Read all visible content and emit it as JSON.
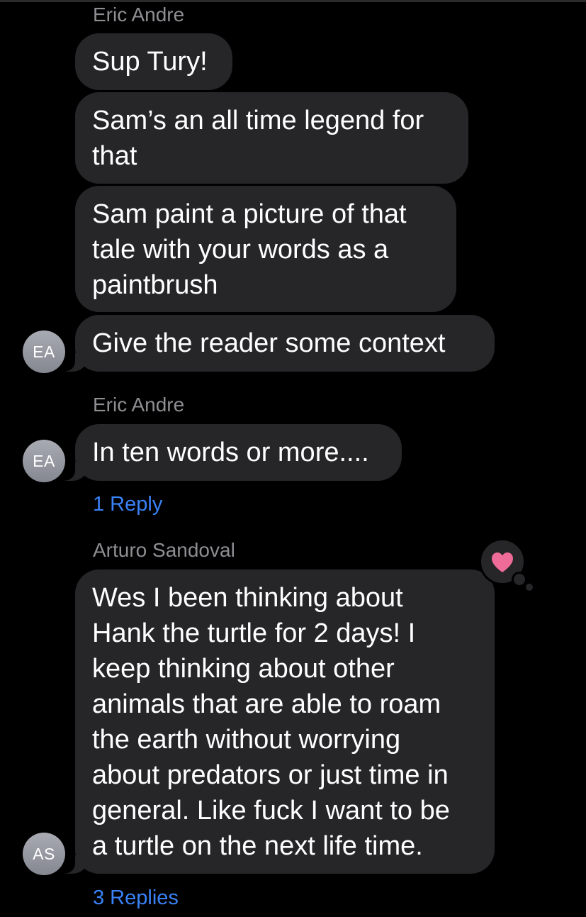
{
  "colors": {
    "background": "#000000",
    "bubble": "#262629",
    "sender_name": "#8e8e93",
    "reply_link": "#3a82f7",
    "heart": "#ee6c97"
  },
  "messages_group_1": {
    "sender": "Eric Andre",
    "bubbles": [
      "Sup Tury!",
      "Sam’s an all time legend for",
      "that",
      "Sam paint a picture of that",
      "tale with your words as a",
      "paintbrush",
      "Give the reader some context"
    ],
    "avatar_initials": "EA"
  },
  "messages_group_2": {
    "sender": "Eric Andre",
    "bubble": "In ten words or more....",
    "avatar_initials": "EA",
    "reply_link": "1 Reply"
  },
  "messages_group_3": {
    "sender": "Arturo Sandoval",
    "lines": [
      "Wes I been thinking about",
      "Hank the turtle for 2 days! I",
      "keep thinking about other",
      "animals that are able to roam",
      "the earth without worrying",
      "about predators or just time in",
      "general. Like fuck I want to be",
      "a turtle on the next life time."
    ],
    "avatar_initials": "AS",
    "reaction_icon": "heart-icon",
    "reply_link": "3 Replies"
  }
}
